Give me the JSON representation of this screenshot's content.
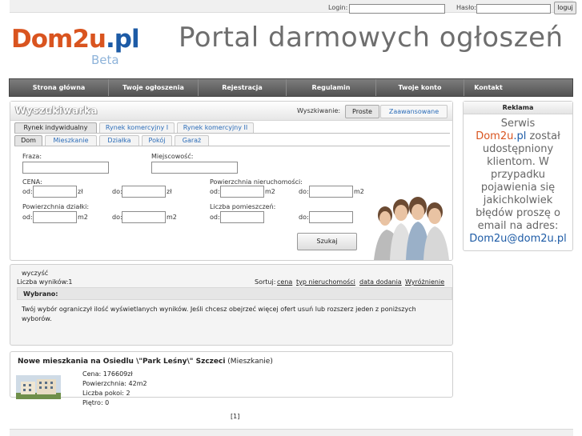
{
  "topbar": {
    "login_label": "Login:",
    "password_label": "Hasło:",
    "login_value": "",
    "password_value": "",
    "login_button": "loguj"
  },
  "logo": {
    "dom": "Dom2u",
    "pl": ".pl",
    "beta": "Beta"
  },
  "headline": "Portal darmowych ogłoszeń",
  "nav": [
    "Strona główna",
    "Twoje ogłoszenia",
    "Rejestracja",
    "Regulamin",
    "Twoje konto",
    "Kontakt"
  ],
  "search": {
    "title": "Wyszukiwarka",
    "mode_label": "Wyszkiwanie:",
    "mode_simple": "Proste",
    "mode_advanced": "Zaawansowane",
    "market_tabs": [
      "Rynek indywidualny",
      "Rynek komercyjny I",
      "Rynek komercyjny II"
    ],
    "type_tabs": [
      "Dom",
      "Mieszkanie",
      "Działka",
      "Pokój",
      "Garaż"
    ],
    "phrase_label": "Fraza:",
    "city_label": "Miejscowość:",
    "price_label": "CENA:",
    "area_label": "Powierzchnia nieruchomości:",
    "plot_area_label": "Powierzchnia działki:",
    "rooms_label": "Liczba pomieszczeń:",
    "from": "od:",
    "to": "do:",
    "unit_zl": "zł",
    "unit_m2": "m2",
    "search_button": "Szukaj"
  },
  "ad": {
    "header": "Reklama",
    "line1": "Serwis",
    "brand_dom": "Dom2u",
    "brand_pl": ".pl",
    "line2": " został udostępniony klientom. W przypadku pojawienia się jakichkolwiek błędów proszę o email na adres:",
    "email": "Dom2u@dom2u.pl"
  },
  "results": {
    "clear": "wyczyść",
    "count": "Liczba wyników:1",
    "sort_label": "Sortuj:",
    "sort_options": [
      "cena",
      "typ nieruchomości",
      "data dodania",
      "Wyróżnienie"
    ],
    "chosen_title": "Wybrano:",
    "chosen_text": "Twój wybór ograniczył ilość wyświetlanych wyników. Jeśli chcesz obejrzeć więcej ofert usuń lub rozszerz jeden z poniższych wyborów."
  },
  "listing": {
    "title": "Nowe mieszkania na Osiedlu \\\"Park Leśny\\\" Szczeci",
    "type": " (Mieszkanie)",
    "price": "Cena: 176609zł",
    "area": "Powierzchnia: 42m2",
    "rooms": "Liczba pokoi: 2",
    "floor": "Piętro: 0"
  },
  "pager": "[1]",
  "colors": {
    "brand_orange": "#d9541f",
    "brand_blue": "#1d5ba6",
    "nav_bg": "#5e5e5e",
    "link": "#2b6cb8"
  }
}
